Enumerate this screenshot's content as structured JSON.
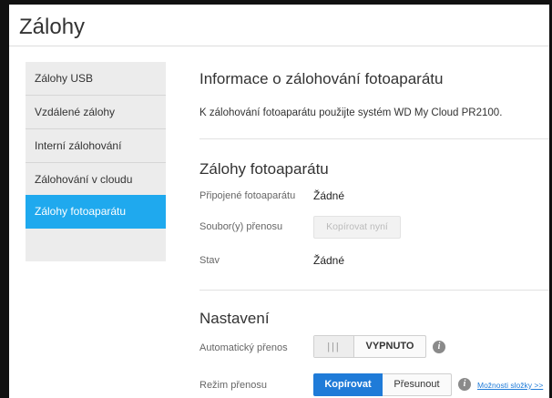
{
  "page": {
    "title": "Zálohy"
  },
  "sidebar": {
    "items": [
      {
        "label": "Zálohy USB",
        "active": false
      },
      {
        "label": "Vzdálené zálohy",
        "active": false
      },
      {
        "label": "Interní zálohování",
        "active": false
      },
      {
        "label": "Zálohování v cloudu",
        "active": false
      },
      {
        "label": "Zálohy fotoaparátu",
        "active": true
      }
    ]
  },
  "info": {
    "heading": "Informace o zálohování fotoaparátu",
    "text": "K zálohování fotoaparátu použijte systém WD My Cloud PR2100."
  },
  "camera": {
    "heading": "Zálohy fotoaparátu",
    "connected_label": "Připojené fotoaparátu",
    "connected_value": "Žádné",
    "files_label": "Soubor(y) přenosu",
    "copy_now_button": "Kopírovat nyní",
    "status_label": "Stav",
    "status_value": "Žádné"
  },
  "settings": {
    "heading": "Nastavení",
    "auto_transfer_label": "Automatický přenos",
    "auto_transfer_knob": "|||",
    "auto_transfer_state": "VYPNUTO",
    "mode_label": "Režim přenosu",
    "mode_copy": "Kopírovat",
    "mode_move": "Přesunout",
    "folder_options_link": "Možnosti složky >>",
    "info_icon_glyph": "i"
  },
  "colors": {
    "accent": "#1fa9ee",
    "button_blue": "#1f7bd8"
  }
}
